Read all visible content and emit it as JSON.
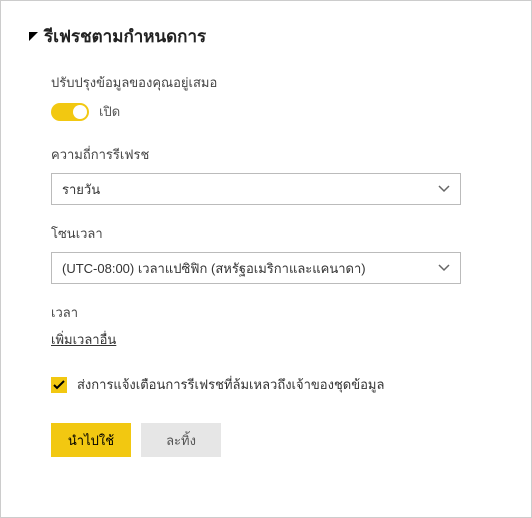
{
  "section": {
    "title": "รีเฟรชตามกำหนดการ"
  },
  "keepDataUpdated": {
    "label": "ปรับปรุงข้อมูลของคุณอยู่เสมอ",
    "status": "เปิด"
  },
  "frequency": {
    "label": "ความถี่การรีเฟรช",
    "value": "รายวัน"
  },
  "timezone": {
    "label": "โซนเวลา",
    "value": "(UTC-08:00) เวลาแปซิฟิก (สหรัฐอเมริกาและแคนาดา)"
  },
  "time": {
    "label": "เวลา",
    "addLink": "เพิ่มเวลาอื่น"
  },
  "notify": {
    "label": "ส่งการแจ้งเตือนการรีเฟรชที่ล้มเหลวถึงเจ้าของชุดข้อมูล"
  },
  "buttons": {
    "apply": "นำไปใช้",
    "discard": "ละทิ้ง"
  }
}
